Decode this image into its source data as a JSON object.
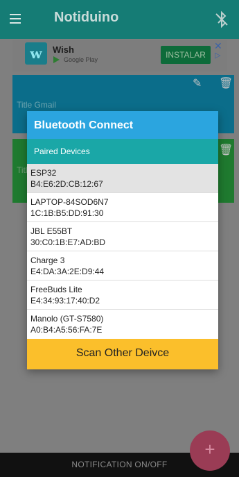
{
  "app": {
    "title": "Notiduino"
  },
  "icons": {
    "menu": "hamburger-icon",
    "bluetooth": "bluetooth-disabled-icon",
    "edit": "pencil-icon",
    "delete": "trash-icon",
    "ad_close": "close-icon",
    "ad_info": "adchoices-icon",
    "add": "plus-icon"
  },
  "ad": {
    "app_name": "Wish",
    "store": "Google Play",
    "install_label": "INSTALAR"
  },
  "cards": [
    {
      "title": "Title  Gmail"
    },
    {
      "title": "Titl"
    }
  ],
  "dialog": {
    "title": "Bluetooth Connect",
    "section": "Paired Devices",
    "devices": [
      {
        "name": "ESP32",
        "mac": "B4:E6:2D:CB:12:67",
        "highlighted": true
      },
      {
        "name": "LAPTOP-84SOD6N7",
        "mac": "1C:1B:B5:DD:91:30"
      },
      {
        "name": "JBL E55BT",
        "mac": "30:C0:1B:E7:AD:BD"
      },
      {
        "name": "Charge 3",
        "mac": "E4:DA:3A:2E:D9:44"
      },
      {
        "name": "FreeBuds Lite",
        "mac": "E4:34:93:17:40:D2"
      },
      {
        "name": "Manolo (GT-S7580)",
        "mac": "A0:B4:A5:56:FA:7E"
      }
    ],
    "scan_button": "Scan Other Deivce"
  },
  "bottom": {
    "label": "NOTIFICATION ON/OFF",
    "fab": "+"
  },
  "colors": {
    "appbar": "#157c75",
    "dialog_header": "#2ba5df",
    "section_header": "#1aa7a7",
    "scan_button": "#fbbf2b",
    "fab": "#9a3c55"
  }
}
